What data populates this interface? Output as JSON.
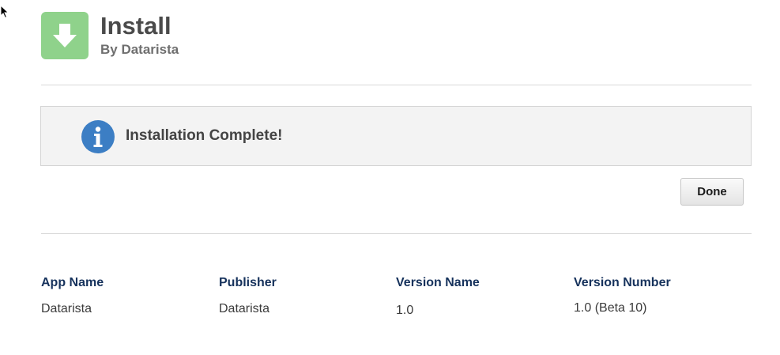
{
  "header": {
    "title": "Install",
    "subtitle": "By Datarista",
    "icon": "download-arrow-icon",
    "icon_color": "#8fd28b"
  },
  "message": {
    "icon": "info-icon",
    "icon_color": "#3c7ec4",
    "text": "Installation Complete!"
  },
  "actions": {
    "done_label": "Done"
  },
  "details": {
    "columns": [
      {
        "label": "App Name",
        "value": "Datarista"
      },
      {
        "label": "Publisher",
        "value": "Datarista"
      },
      {
        "label": "Version Name",
        "value": "1.0"
      },
      {
        "label": "Version Number",
        "value": "1.0 (Beta 10)"
      }
    ],
    "label_color": "#16325c"
  }
}
